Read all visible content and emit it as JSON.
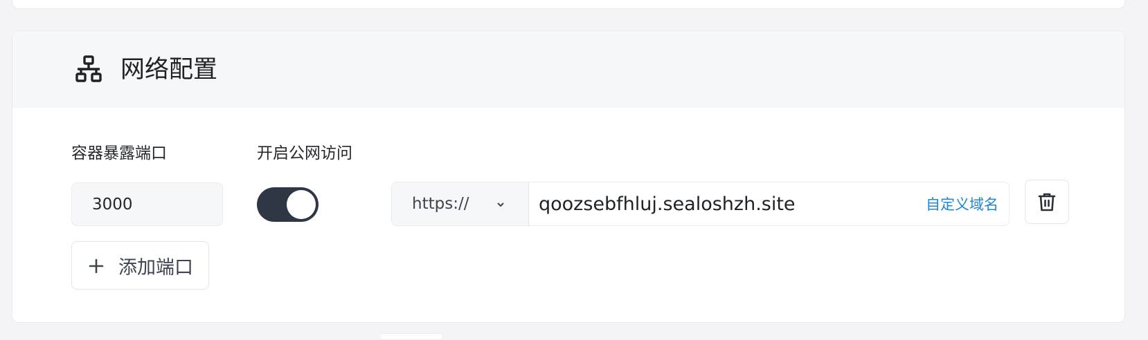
{
  "section": {
    "title": "网络配置",
    "icon": "network-icon"
  },
  "port_field": {
    "label": "容器暴露端口",
    "value": "3000"
  },
  "public_access": {
    "label": "开启公网访问",
    "enabled": true
  },
  "url": {
    "protocol": "https://",
    "domain": "qoozsebfhluj.sealoshzh.site",
    "custom_domain_link": "自定义域名"
  },
  "actions": {
    "add_port_label": "添加端口",
    "delete_icon": "trash-icon",
    "add_icon": "plus-icon"
  },
  "colors": {
    "toggle_on": "#2f3745",
    "link": "#1d88d8",
    "header_bg": "#f6f7f9"
  }
}
